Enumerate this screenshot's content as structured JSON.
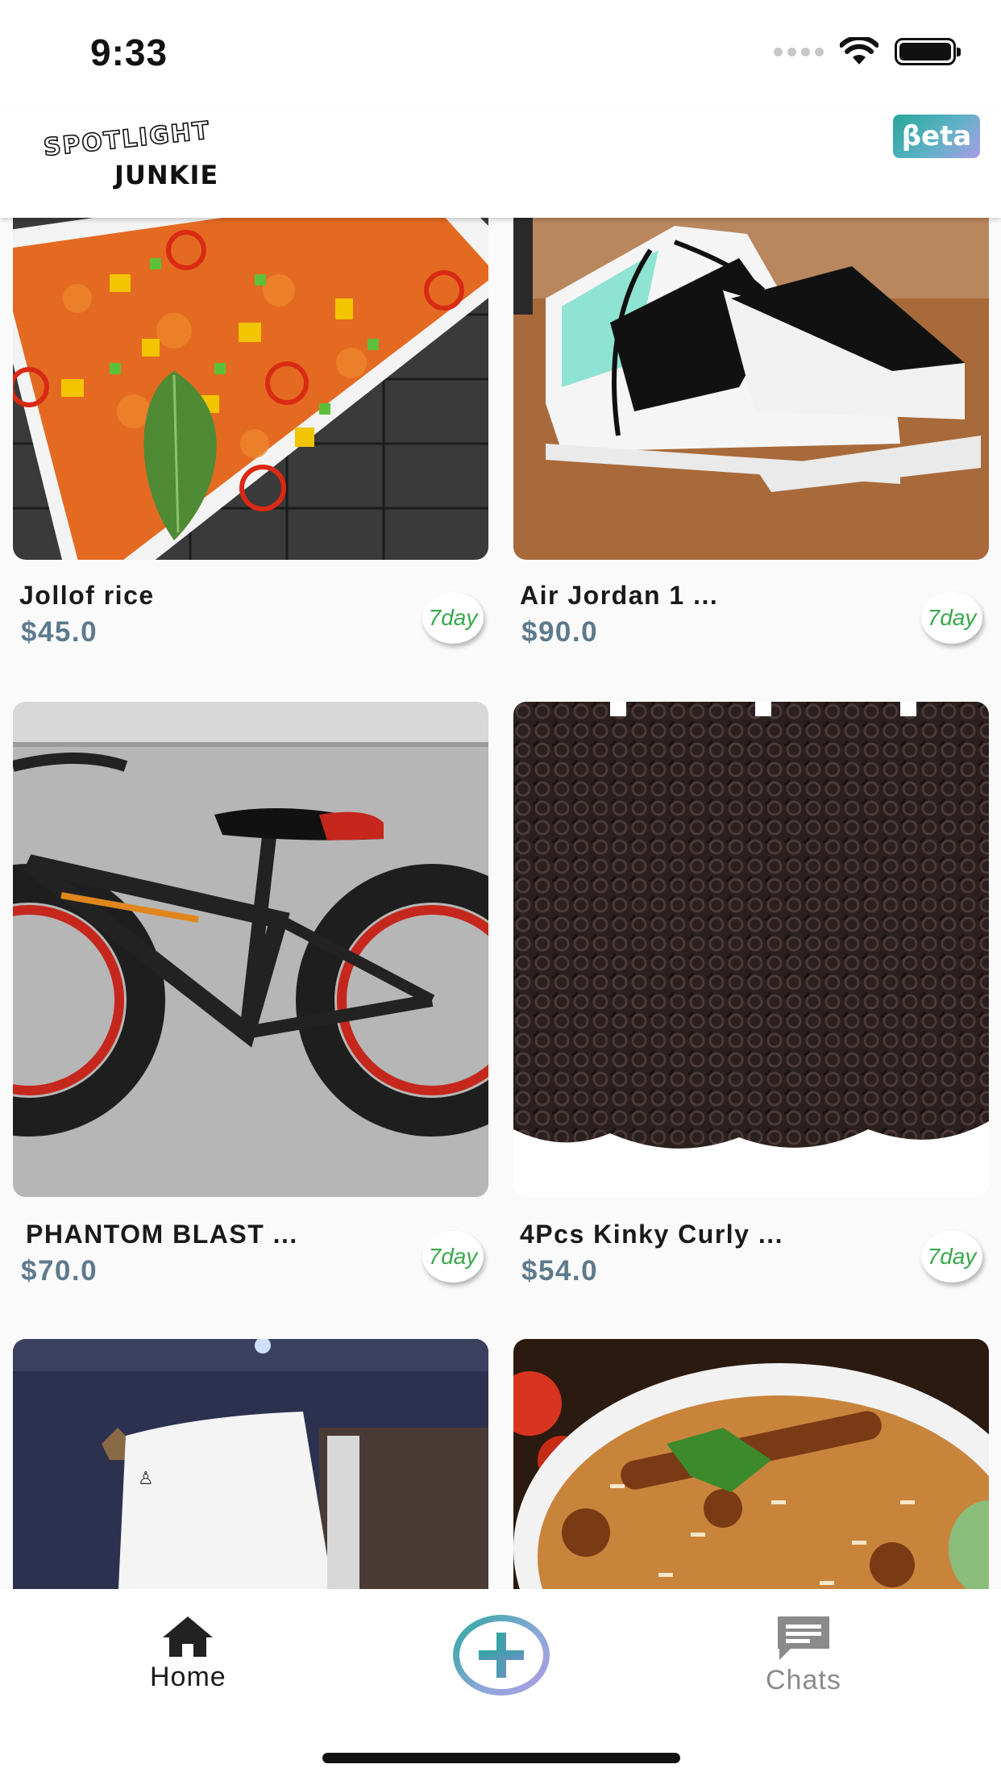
{
  "status_bar": {
    "time": "9:33"
  },
  "header": {
    "logo_top": "SPOTLIGHT",
    "logo_bottom": "JUNKIE",
    "beta_label": "βeta"
  },
  "listings": [
    {
      "title": "Jollof rice",
      "price": "$45.0",
      "badge": "7day",
      "image": "jollof-rice-photo"
    },
    {
      "title": "Air Jordan 1 ...",
      "price": "$90.0",
      "badge": "7day",
      "image": "sneakers-photo"
    },
    {
      "title": "PHANTOM BLAST ...",
      "price": "$70.0",
      "badge": "7day",
      "image": "fat-tire-bike-photo"
    },
    {
      "title": "4Pcs Kinky Curly ...",
      "price": "$54.0",
      "badge": "7day",
      "image": "curly-hair-photo"
    },
    {
      "image": "console-photo"
    },
    {
      "image": "biryani-photo"
    }
  ],
  "bottom_nav": {
    "home_label": "Home",
    "chats_label": "Chats",
    "active": "home"
  },
  "colors": {
    "price": "#5e7a8c",
    "badge_text": "#39a84b",
    "accent_teal": "#2aa9a0",
    "accent_lavender": "#b09be4",
    "inactive_nav": "#8a8a8a"
  }
}
